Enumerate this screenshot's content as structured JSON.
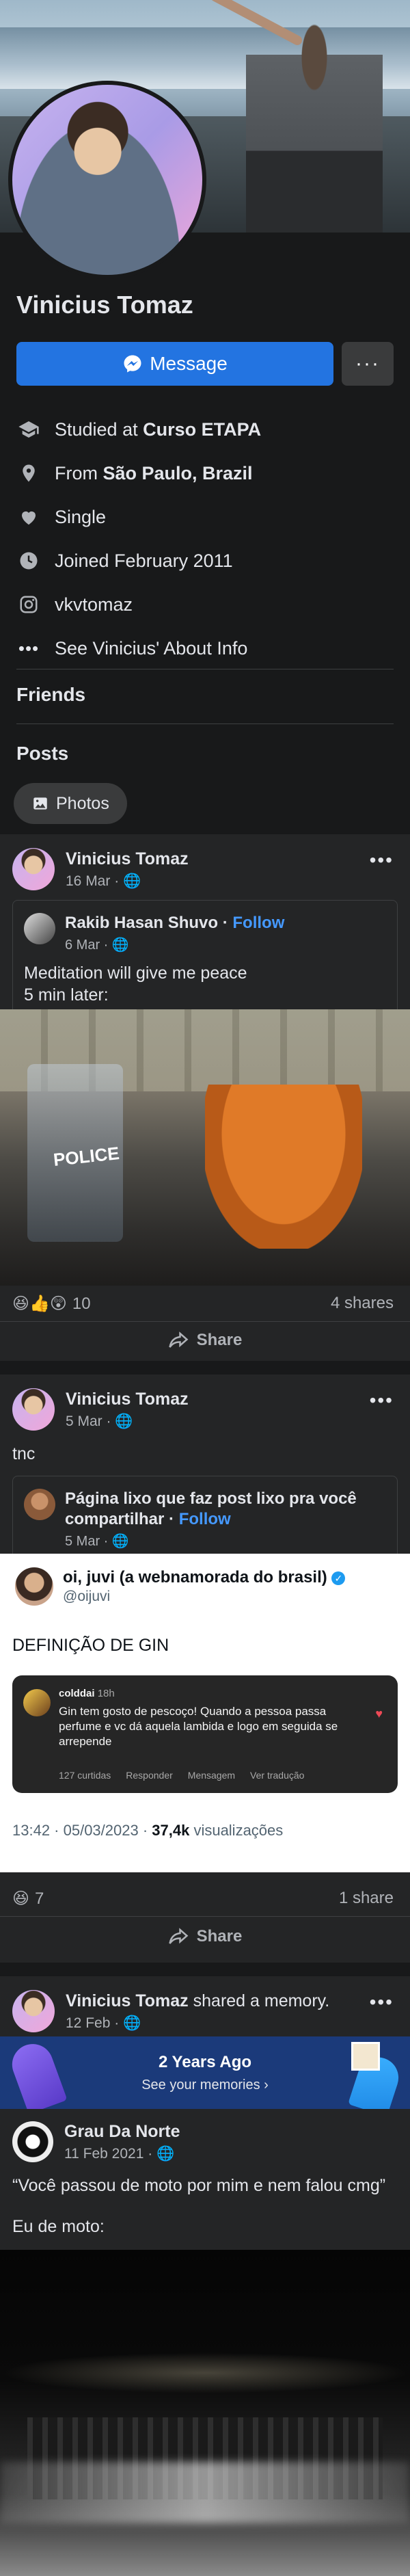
{
  "profile": {
    "name": "Vinicius Tomaz",
    "message_label": "Message",
    "more_label": "···"
  },
  "info": [
    {
      "icon": "graduation-cap-icon",
      "prefix": "Studied at ",
      "strong": "Curso ETAPA"
    },
    {
      "icon": "location-pin-icon",
      "prefix": "From ",
      "strong": "São Paulo, Brazil"
    },
    {
      "icon": "heart-icon",
      "prefix": "Single",
      "strong": ""
    },
    {
      "icon": "clock-icon",
      "prefix": "Joined February 2011",
      "strong": ""
    },
    {
      "icon": "instagram-icon",
      "prefix": "vkvtomaz",
      "strong": ""
    },
    {
      "icon": "more-icon",
      "prefix": "See Vinicius' About Info",
      "strong": ""
    }
  ],
  "sections": {
    "friends": "Friends",
    "posts": "Posts",
    "photos_button": "Photos"
  },
  "posts": [
    {
      "author": "Vinicius Tomaz",
      "time": "16 Mar · ",
      "shared": {
        "author": "Rakib Hasan Shuvo",
        "follow": "Follow",
        "time": "6 Mar · ",
        "text_line1": "Meditation will give me peace",
        "text_line2": "5 min later:"
      },
      "photo_text": "POLICE",
      "reactions_count": "10",
      "shares": "4 shares",
      "share_label": "Share"
    },
    {
      "author": "Vinicius Tomaz",
      "time": "5 Mar · ",
      "text": "tnc",
      "shared": {
        "author_line1": "Página lixo que faz post lixo pra você",
        "author_line2": "compartilhar",
        "follow": "Follow",
        "time": "5 Mar · "
      },
      "tweet": {
        "name": "oi, juvi (a webnamorada do brasil)",
        "handle": "@oijuvi",
        "text": "DEFINIÇÃO DE GIN",
        "comment": {
          "user": "colddai",
          "age": "18h",
          "text": "Gin tem gosto de pescoço! Quando a pessoa passa perfume e vc dá aquela lambida e logo em seguida se arrepende",
          "meta": [
            "127 curtidas",
            "Responder",
            "Mensagem",
            "Ver tradução"
          ]
        },
        "footer_time": "13:42 · 05/03/2023 · ",
        "footer_views": "37,4k",
        "footer_views_label": " visualizações"
      },
      "reactions_count": "7",
      "shares": "1 share",
      "share_label": "Share"
    },
    {
      "author": "Vinicius Tomaz",
      "action": " shared a memory.",
      "time": "12 Feb · ",
      "memory": {
        "title": "2 Years Ago",
        "subtitle": "See your memories ›"
      },
      "inner": {
        "author": "Grau Da Norte",
        "time": "11 Feb 2021 · ",
        "text": "“Você passou de moto por mim e nem falou cmg”",
        "text2": "Eu de moto:"
      }
    }
  ],
  "colors": {
    "accent": "#2374e1",
    "background": "#18191a",
    "card": "#242526",
    "follow": "#4599ff"
  }
}
